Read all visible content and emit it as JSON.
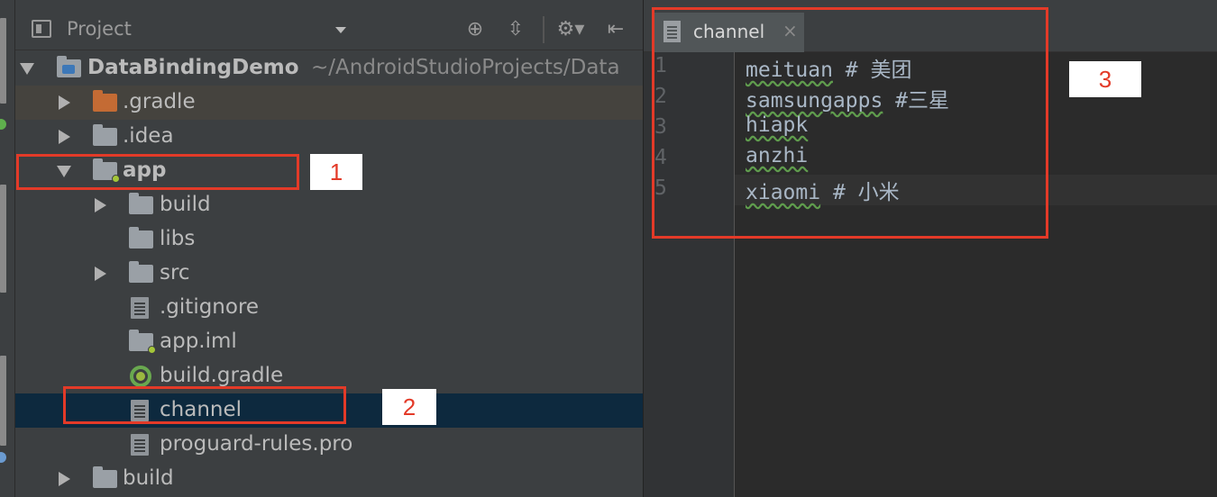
{
  "panel": {
    "title": "Project",
    "icons": [
      "locate-icon",
      "collapse-all-icon",
      "gear-icon",
      "hide-panel-icon"
    ]
  },
  "tree": [
    {
      "label": "DataBindingDemo",
      "hint": "~/AndroidStudioProjects/Data",
      "icon": "module-folder-icon",
      "expanded": true
    },
    {
      "label": ".gradle",
      "icon": "folder-icon",
      "expanded": false
    },
    {
      "label": ".idea",
      "icon": "folder-icon",
      "expanded": false
    },
    {
      "label": "app",
      "icon": "android-module-folder-icon",
      "expanded": true
    },
    {
      "label": "build",
      "icon": "folder-icon",
      "expanded": false
    },
    {
      "label": "libs",
      "icon": "folder-icon"
    },
    {
      "label": "src",
      "icon": "folder-icon",
      "expanded": false
    },
    {
      "label": ".gitignore",
      "icon": "text-file-icon"
    },
    {
      "label": "app.iml",
      "icon": "module-file-icon"
    },
    {
      "label": "build.gradle",
      "icon": "gradle-icon"
    },
    {
      "label": "channel",
      "icon": "text-file-icon",
      "selected": true
    },
    {
      "label": "proguard-rules.pro",
      "icon": "text-file-icon"
    },
    {
      "label": "build",
      "icon": "folder-icon",
      "expanded": false
    }
  ],
  "editor": {
    "tab_label": "channel",
    "tab_close": "×",
    "line_numbers": [
      "1",
      "2",
      "3",
      "4",
      "5"
    ],
    "lines": [
      {
        "word": "meituan",
        "rest": " # 美团"
      },
      {
        "word": "samsungapps",
        "rest": " #三星"
      },
      {
        "word": "hiapk",
        "rest": ""
      },
      {
        "word": "anzhi",
        "rest": ""
      },
      {
        "word": "xiaomi",
        "rest": " # 小米"
      }
    ]
  },
  "annotations": [
    "1",
    "2",
    "3"
  ],
  "colors": {
    "annotation": "#e33a28",
    "selection": "#0d293e",
    "panel_bg": "#3c3f41",
    "editor_bg": "#2b2b2b"
  }
}
